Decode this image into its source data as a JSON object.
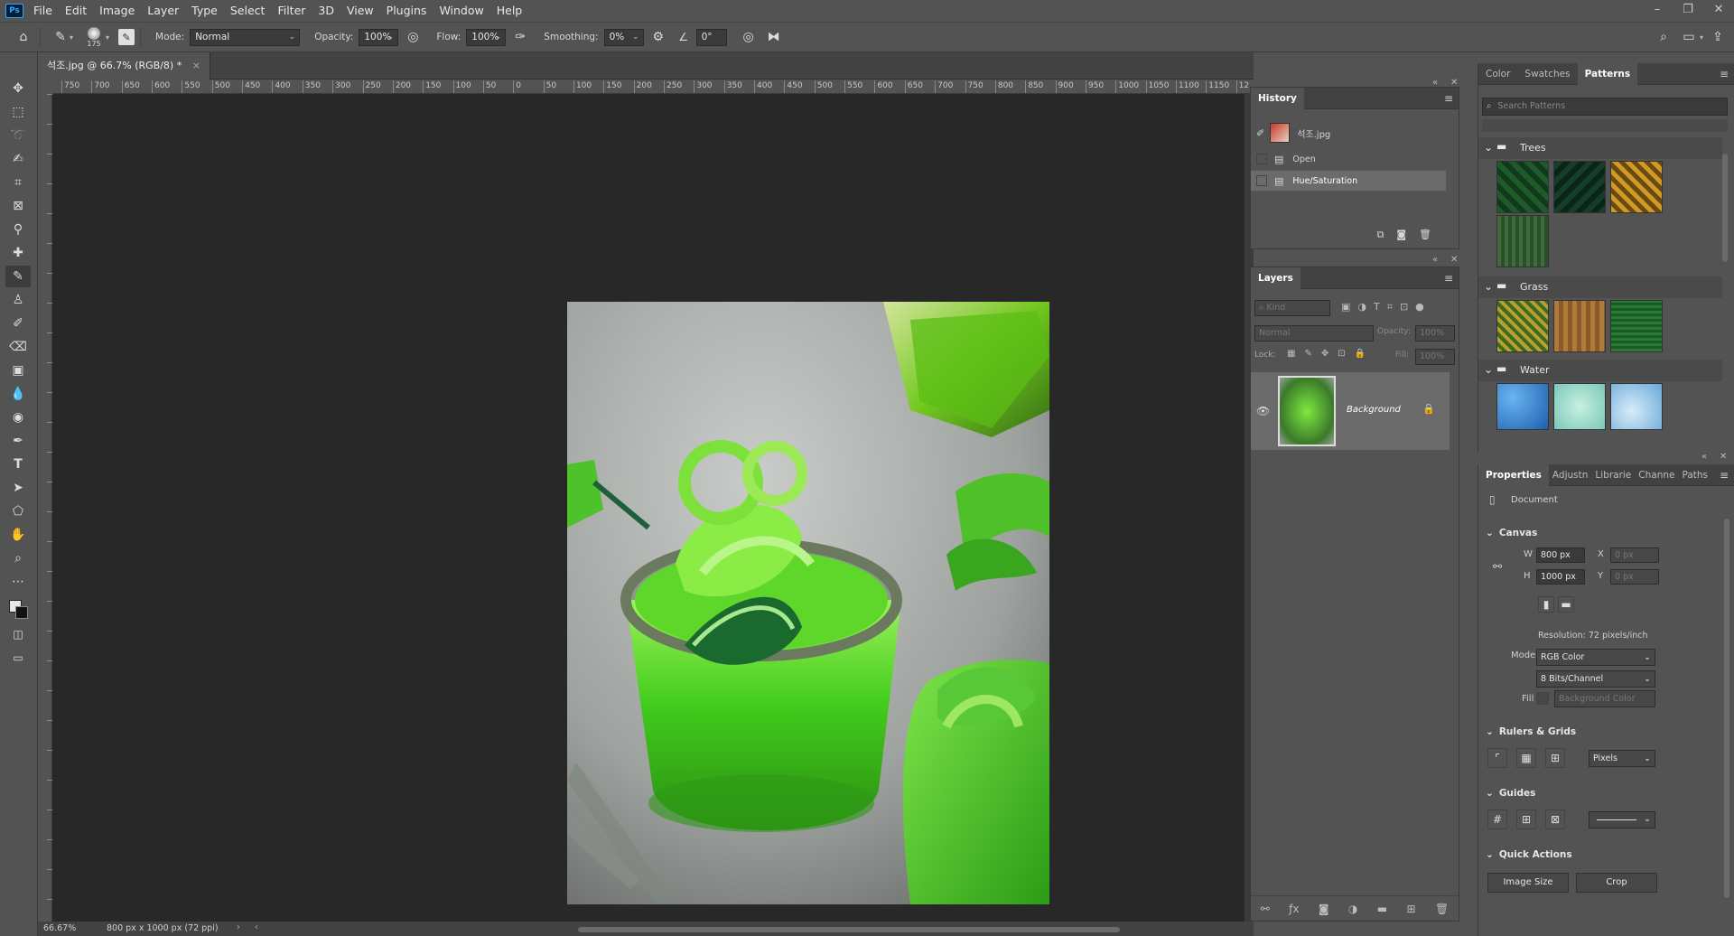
{
  "menubar": {
    "logo": "Ps",
    "items": [
      "File",
      "Edit",
      "Image",
      "Layer",
      "Type",
      "Select",
      "Filter",
      "3D",
      "View",
      "Plugins",
      "Window",
      "Help"
    ],
    "window_controls": [
      "–",
      "❐",
      "✕"
    ]
  },
  "options": {
    "brush_size": "175",
    "mode_label": "Mode:",
    "mode_value": "Normal",
    "opacity_label": "Opacity:",
    "opacity_value": "100%",
    "flow_label": "Flow:",
    "flow_value": "100%",
    "smoothing_label": "Smoothing:",
    "smoothing_value": "0%",
    "angle_value": "0°"
  },
  "document": {
    "tab_title": "석조.jpg @ 66.7% (RGB/8) *",
    "close": "×",
    "zoom": "66.67%",
    "dimensions": "800 px x 1000 px (72 ppi)",
    "ruler_labels": [
      "750",
      "700",
      "650",
      "600",
      "550",
      "500",
      "450",
      "400",
      "350",
      "300",
      "250",
      "200",
      "150",
      "100",
      "50",
      "0",
      "50",
      "100",
      "150",
      "200",
      "250",
      "300",
      "350",
      "400",
      "450",
      "500",
      "550",
      "600",
      "650",
      "700",
      "750",
      "800",
      "850",
      "900",
      "950",
      "1000",
      "1050",
      "1100",
      "1150",
      "12"
    ]
  },
  "history": {
    "title": "History",
    "snapshot": "석조.jpg",
    "items": [
      "Open",
      "Hue/Saturation"
    ]
  },
  "layers": {
    "title": "Layers",
    "kind_placeholder": "Kind",
    "blend_mode": "Normal",
    "opacity_label": "Opacity:",
    "opacity_value": "100%",
    "lock_label": "Lock:",
    "fill_label": "Fill:",
    "fill_value": "100%",
    "layer_name": "Background"
  },
  "color_panel": {
    "tabs": [
      "Color",
      "Swatches",
      "Patterns"
    ],
    "active_tab": "Patterns",
    "search_placeholder": "Search Patterns",
    "folders": [
      "Trees",
      "Grass",
      "Water"
    ]
  },
  "properties": {
    "tabs": [
      "Properties",
      "Adjustn",
      "Librarie",
      "Channe",
      "Paths"
    ],
    "doc_label": "Document",
    "canvas_section": "Canvas",
    "w_label": "W",
    "w_value": "800 px",
    "h_label": "H",
    "h_value": "1000 px",
    "x_label": "X",
    "x_value": "0 px",
    "y_label": "Y",
    "y_value": "0 px",
    "resolution": "Resolution: 72 pixels/inch",
    "mode_label": "Mode",
    "mode_value": "RGB Color",
    "bits_value": "8 Bits/Channel",
    "fill_label": "Fill",
    "fill_value": "Background Color",
    "rulers_section": "Rulers & Grids",
    "units_value": "Pixels",
    "guides_section": "Guides",
    "quick_actions_section": "Quick Actions",
    "image_size_button": "Image Size",
    "crop_button": "Crop"
  },
  "colors": {
    "bg": "#535353",
    "canvas": "#282828",
    "panel_head": "#424242",
    "accent": "#31a8ff"
  }
}
